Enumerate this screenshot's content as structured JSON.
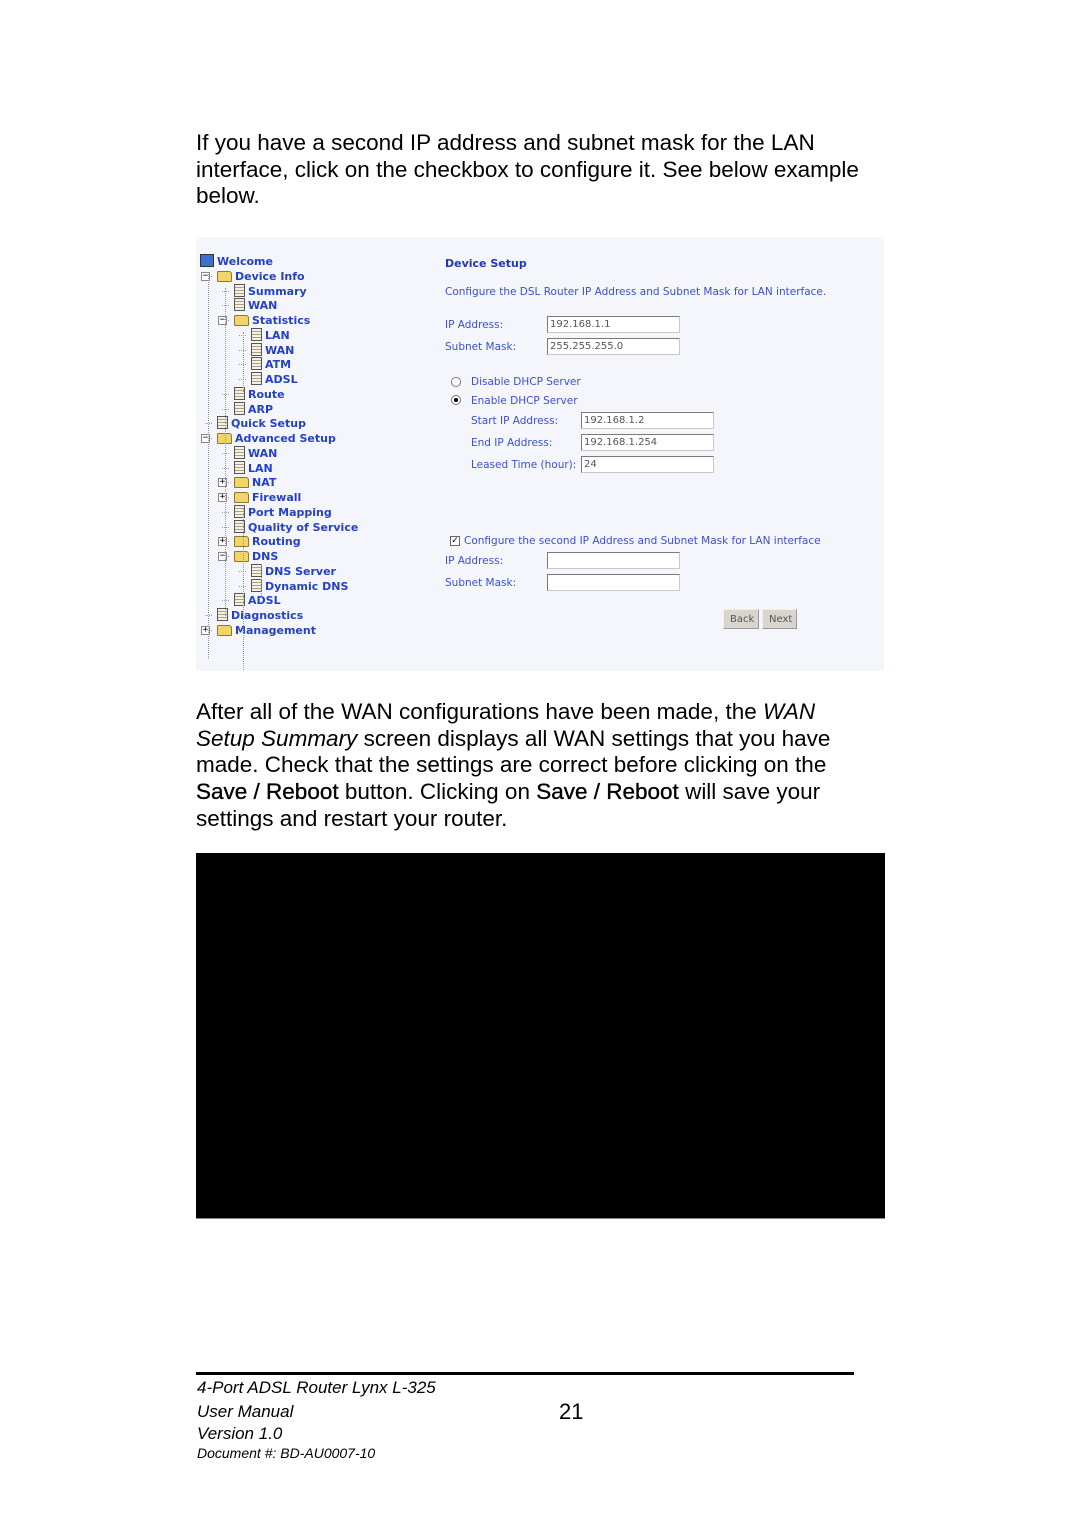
{
  "paragraph1": "If you have a second IP address and subnet mask for the LAN interface, click on the checkbox to configure it.  See below example below.",
  "paragraph2": {
    "t1": "After all of the WAN configurations have been made, the ",
    "em1": "WAN Setup Summary",
    "t2": " screen displays all WAN settings that you have made.  Check that the settings are correct before clicking on the ",
    "b1": "Save / Reboot",
    "t3": " button.  Clicking on ",
    "b2": "Save / Reboot",
    "t4": " will save your settings and restart your router."
  },
  "router_ui": {
    "tree": [
      {
        "label": "Welcome",
        "icon": "computer-icon",
        "level": 0
      },
      {
        "label": "Device Info",
        "icon": "folder-open-icon",
        "level": 1,
        "expander": "minus"
      },
      {
        "label": "Summary",
        "icon": "document-icon",
        "level": 2
      },
      {
        "label": "WAN",
        "icon": "document-icon",
        "level": 2
      },
      {
        "label": "Statistics",
        "icon": "folder-open-icon",
        "level": 2,
        "expander": "minus"
      },
      {
        "label": "LAN",
        "icon": "document-icon",
        "level": 3
      },
      {
        "label": "WAN",
        "icon": "document-icon",
        "level": 3
      },
      {
        "label": "ATM",
        "icon": "document-icon",
        "level": 3
      },
      {
        "label": "ADSL",
        "icon": "document-icon",
        "level": 3
      },
      {
        "label": "Route",
        "icon": "document-icon",
        "level": 2
      },
      {
        "label": "ARP",
        "icon": "document-icon",
        "level": 2
      },
      {
        "label": "Quick Setup",
        "icon": "document-icon",
        "level": 1
      },
      {
        "label": "Advanced Setup",
        "icon": "folder-open-icon",
        "level": 1,
        "expander": "minus"
      },
      {
        "label": "WAN",
        "icon": "document-icon",
        "level": 2
      },
      {
        "label": "LAN",
        "icon": "document-icon",
        "level": 2
      },
      {
        "label": "NAT",
        "icon": "folder-icon",
        "level": 2,
        "expander": "plus"
      },
      {
        "label": "Firewall",
        "icon": "folder-icon",
        "level": 2,
        "expander": "plus"
      },
      {
        "label": "Port Mapping",
        "icon": "document-icon",
        "level": 2
      },
      {
        "label": "Quality of Service",
        "icon": "document-icon",
        "level": 2
      },
      {
        "label": "Routing",
        "icon": "folder-icon",
        "level": 2,
        "expander": "plus"
      },
      {
        "label": "DNS",
        "icon": "folder-open-icon",
        "level": 2,
        "expander": "minus"
      },
      {
        "label": "DNS Server",
        "icon": "document-icon",
        "level": 3
      },
      {
        "label": "Dynamic DNS",
        "icon": "document-icon",
        "level": 3
      },
      {
        "label": "ADSL",
        "icon": "document-icon",
        "level": 2
      },
      {
        "label": "Diagnostics",
        "icon": "document-icon",
        "level": 1
      },
      {
        "label": "Management",
        "icon": "folder-icon",
        "level": 1,
        "expander": "plus"
      }
    ],
    "title": "Device Setup",
    "description": "Configure the DSL Router IP Address and Subnet Mask for LAN interface.",
    "ip_label": "IP Address:",
    "ip_value": "192.168.1.1",
    "mask_label": "Subnet Mask:",
    "mask_value": "255.255.255.0",
    "dhcp_disable_label": "Disable DHCP Server",
    "dhcp_enable_label": "Enable DHCP Server",
    "dhcp_selected": "enable",
    "start_ip_label": "Start IP Address:",
    "start_ip_value": "192.168.1.2",
    "end_ip_label": "End IP Address:",
    "end_ip_value": "192.168.1.254",
    "lease_label": "Leased Time (hour):",
    "lease_value": "24",
    "second_ip_checkbox_label": "Configure the second IP Address and Subnet Mask for LAN interface",
    "second_ip_checked": true,
    "second_ip_label": "IP Address:",
    "second_ip_value": "",
    "second_mask_label": "Subnet Mask:",
    "second_mask_value": "",
    "back_label": "Back",
    "next_label": "Next"
  },
  "footer": {
    "product": "4-Port ADSL Router Lynx L-325",
    "manual": "User Manual",
    "version": "Version 1.0",
    "document": "Document #:  BD-AU0007-10",
    "page_number": "21"
  }
}
